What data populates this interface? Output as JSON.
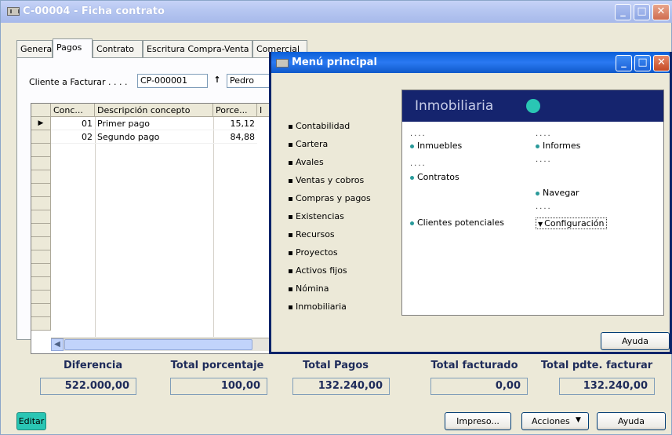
{
  "window": {
    "title": "C-00004 - Ficha contrato"
  },
  "tabs": [
    {
      "label": "General",
      "selected": false
    },
    {
      "label": "Pagos",
      "selected": true
    },
    {
      "label": "Contrato",
      "selected": false
    },
    {
      "label": "Escritura Compra-Venta",
      "selected": false
    },
    {
      "label": "Comercial",
      "selected": false
    }
  ],
  "cliente": {
    "label": "Cliente a Facturar . . . .",
    "code": "CP-000001",
    "name": "Pedro"
  },
  "grid": {
    "headers": [
      "Conc...",
      "Descripción concepto",
      "Porce...",
      "I"
    ],
    "rows": [
      {
        "conc": "01",
        "desc": "Primer pago",
        "porc": "15,12"
      },
      {
        "conc": "02",
        "desc": "Segundo pago",
        "porc": "84,88"
      }
    ]
  },
  "summary": [
    {
      "label": "Diferencia",
      "value": "522.000,00"
    },
    {
      "label": "Total porcentaje",
      "value": "100,00"
    },
    {
      "label": "Total Pagos",
      "value": "132.240,00"
    },
    {
      "label": "Total facturado",
      "value": "0,00"
    },
    {
      "label": "Total pdte. facturar",
      "value": "132.240,00"
    }
  ],
  "footer": {
    "edit": "Editar",
    "print": "Impreso...",
    "actions": "Acciones",
    "help": "Ayuda"
  },
  "menu": {
    "title": "Menú principal",
    "items": [
      "Contabilidad",
      "Cartera",
      "Avales",
      "Ventas y cobros",
      "Compras y pagos",
      "Existencias",
      "Recursos",
      "Proyectos",
      "Activos fijos",
      "Nómina",
      "Inmobiliaria"
    ],
    "panel_title": "Inmobiliaria",
    "links": {
      "inmuebles": "Inmuebles",
      "contratos": "Contratos",
      "clientes": "Clientes potenciales",
      "informes": "Informes",
      "navegar": "Navegar",
      "configuracion": "Configuración"
    },
    "help": "Ayuda"
  },
  "colors": {
    "titlebar_inactive": "#b4c5f0",
    "titlebar_active": "#2a79f2",
    "panel_header": "#15246e",
    "accent_dot": "#2ac6b4"
  }
}
